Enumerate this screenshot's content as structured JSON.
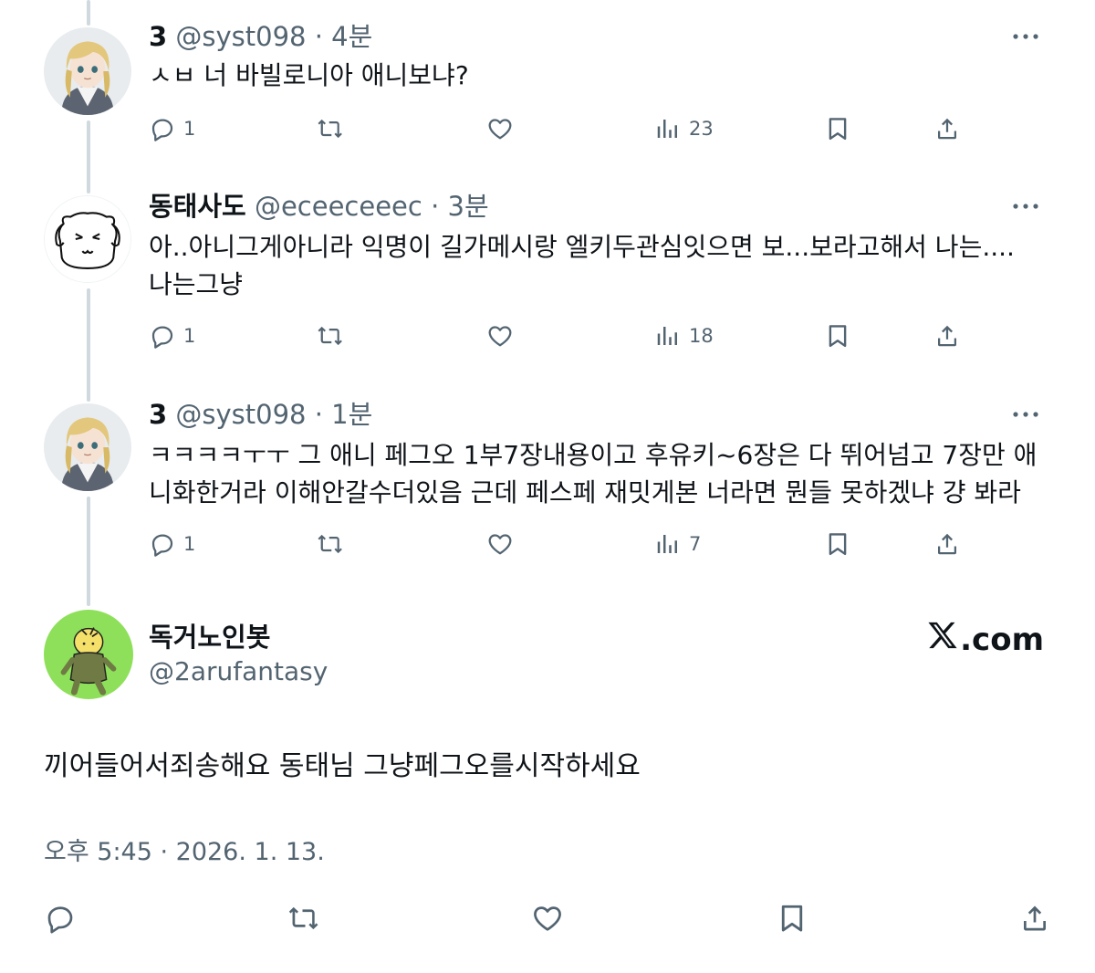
{
  "replies": [
    {
      "name": "3",
      "handle": "@syst098",
      "dot": "·",
      "time": "4분",
      "text": "ㅅㅂ 너 바빌로니아 애니보냐?",
      "counts": {
        "reply": "1",
        "retweet": "",
        "like": "",
        "views": "23"
      }
    },
    {
      "name": "동태사도",
      "handle": "@eceeceeec",
      "dot": "·",
      "time": "3분",
      "text": "아..아니그게아니라 익명이 길가메시랑 엘키두관심잇으면 보...보라고해서 나는.... 나는그냥",
      "counts": {
        "reply": "1",
        "retweet": "",
        "like": "",
        "views": "18"
      }
    },
    {
      "name": "3",
      "handle": "@syst098",
      "dot": "·",
      "time": "1분",
      "text": "ㅋㅋㅋㅋㅜㅜ 그 애니 페그오 1부7장내용이고 후유키~6장은 다 뛰어넘고 7장만 애니화한거라 이해안갈수더있음 근데 페스페 재밋게본 너라면 뭔들 못하겠냐 걍 봐라",
      "counts": {
        "reply": "1",
        "retweet": "",
        "like": "",
        "views": "7"
      }
    }
  ],
  "main": {
    "name": "독거노인봇",
    "handle": "@2arufantasy",
    "brand": ".com",
    "text": "끼어들어서죄송해요 동태님 그냥페그오를시작하세요",
    "meta": "오후 5:45 · 2026. 1. 13."
  },
  "icons": {
    "reply": "reply-icon",
    "retweet": "retweet-icon",
    "like": "heart-icon",
    "views": "views-icon",
    "bookmark": "bookmark-icon",
    "share": "share-icon",
    "more": "more-icon",
    "brand": "x-logo-icon"
  },
  "colors": {
    "text": "#0f1419",
    "secondary": "#536471",
    "thread_line": "#cfd9de",
    "avatar_green": "#8ee05a"
  }
}
